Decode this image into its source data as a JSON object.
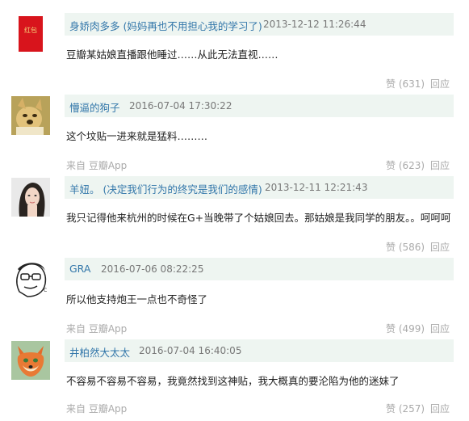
{
  "comments": [
    {
      "user": "身娇肉多多 (妈妈再也不用担心我的学习了)",
      "time": "2013-12-12 11:26:44",
      "content": "豆瓣某姑娘直播跟他睡过……从此无法直视……",
      "source": "",
      "like": "赞 (631)",
      "reply": "回应",
      "avatar_text": "红包"
    },
    {
      "user": "懵逼的狗子",
      "time": "2016-07-04 17:30:22",
      "content": "这个坟贴一进来就是猛料………",
      "source": "来自 豆瓣App",
      "like": "赞 (623)",
      "reply": "回应"
    },
    {
      "user": "羊妞。 (决定我们行为的终究是我们的感情)",
      "time": "2013-12-11 12:21:43",
      "content": "我只记得他来杭州的时候在G+当晚带了个姑娘回去。那姑娘是我同学的朋友。。呵呵呵",
      "source": "",
      "like": "赞 (586)",
      "reply": "回应"
    },
    {
      "user": "GRA",
      "time": "2016-07-06 08:22:25",
      "content": "所以他支持炮王一点也不奇怪了",
      "source": "来自 豆瓣App",
      "like": "赞 (499)",
      "reply": "回应"
    },
    {
      "user": "井柏然大太太",
      "time": "2016-07-04 16:40:05",
      "content": "不容易不容易不容易，我竟然找到这神贴，我大概真的要沦陷为他的迷妹了",
      "source": "来自 豆瓣App",
      "like": "赞 (257)",
      "reply": "回应"
    }
  ],
  "colors": {
    "header_bg": "#eef5f1",
    "username": "#3377aa",
    "meta": "#aaaaaa"
  }
}
